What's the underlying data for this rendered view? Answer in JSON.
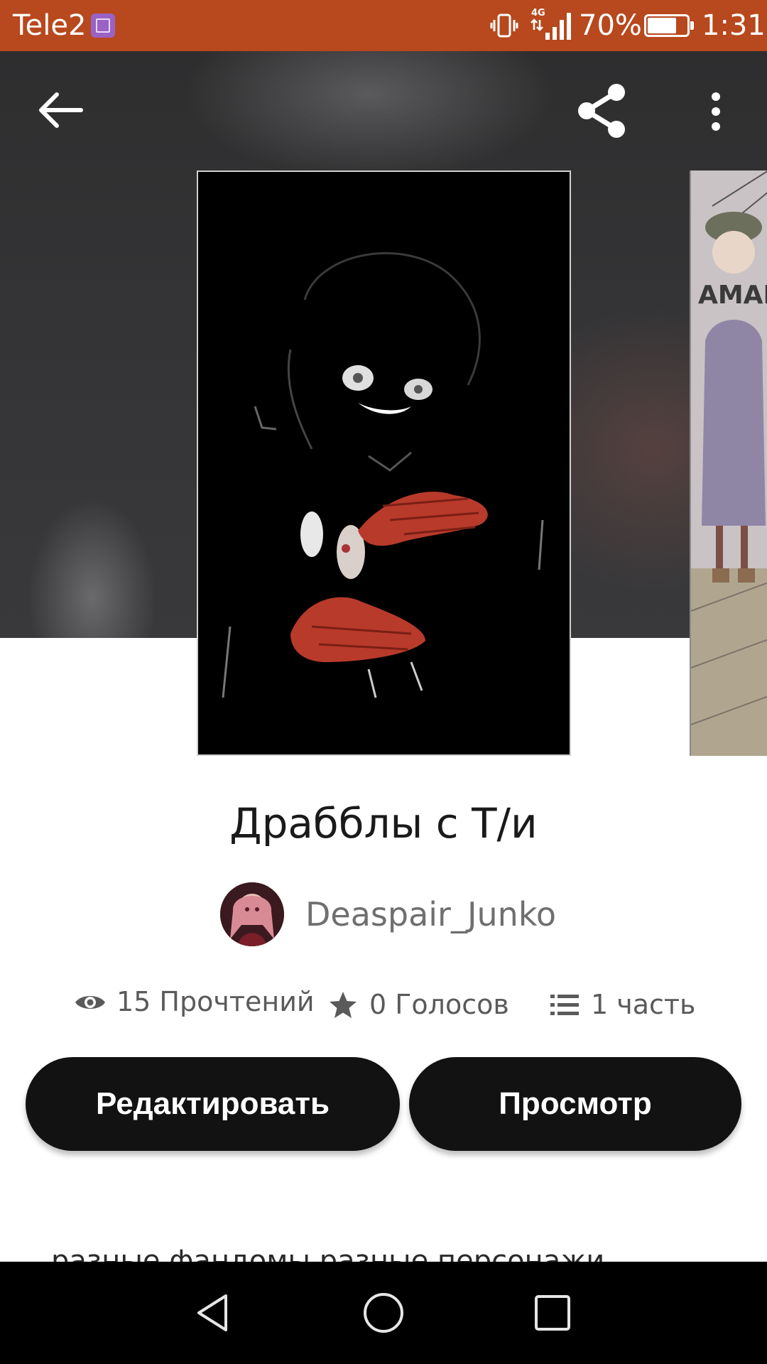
{
  "status_bar": {
    "carrier": "Tele2",
    "network": "4G",
    "battery_percent": "70%",
    "time": "1:31",
    "icons": [
      "gallery-icon",
      "vibrate-icon",
      "signal-icon",
      "battery-icon"
    ]
  },
  "toolbar": {
    "back_icon": "arrow-left-icon",
    "share_icon": "share-icon",
    "more_icon": "more-vertical-icon"
  },
  "covers": {
    "next_cover_text": "AMAH"
  },
  "book": {
    "title": "Драбблы с Т/и",
    "author": "Deaspair_Junko",
    "description": "разные фандомы разные персонажи"
  },
  "stats": {
    "reads": "15 Прочтений",
    "reads_icon": "eye-icon",
    "votes": "0 Голосов",
    "votes_icon": "star-icon",
    "parts": "1 часть",
    "parts_icon": "list-icon"
  },
  "actions": {
    "edit_label": "Редактировать",
    "view_label": "Просмотр"
  },
  "colors": {
    "status_bar": "#b8481d",
    "button_bg": "#121212",
    "button_text": "#ffffff",
    "cover_accent": "#b83a2a"
  }
}
